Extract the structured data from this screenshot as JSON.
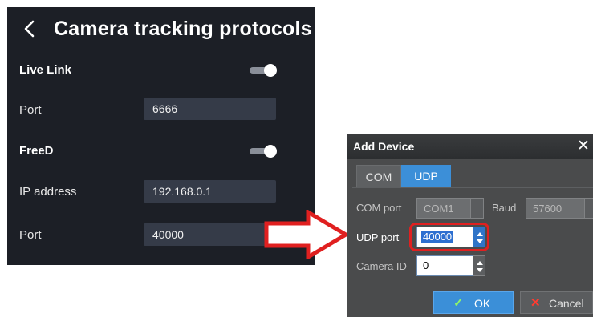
{
  "mobile": {
    "title": "Camera tracking protocols",
    "live_link": {
      "label": "Live Link",
      "enabled": true
    },
    "live_link_port": {
      "label": "Port",
      "value": "6666"
    },
    "freed": {
      "label": "FreeD",
      "enabled": true
    },
    "ip_address": {
      "label": "IP address",
      "value": "192.168.0.1"
    },
    "freed_port": {
      "label": "Port",
      "value": "40000"
    }
  },
  "dialog": {
    "title": "Add Device",
    "close_glyph": "✕",
    "tabs": [
      {
        "label": "COM",
        "active": false
      },
      {
        "label": "UDP",
        "active": true
      }
    ],
    "com_port": {
      "label": "COM port",
      "value": "COM1"
    },
    "baud": {
      "label": "Baud",
      "value": "57600"
    },
    "udp_port": {
      "label": "UDP port",
      "value": "40000"
    },
    "camera_id": {
      "label": "Camera ID",
      "value": "0"
    },
    "ok": {
      "label": "OK",
      "icon": "checkmark-icon",
      "glyph": "✓"
    },
    "cancel": {
      "label": "Cancel",
      "icon": "x-icon",
      "glyph": "✕"
    }
  },
  "colors": {
    "panel_bg": "#1c1f26",
    "field_bg": "#353b48",
    "accent_blue": "#3b8fd8",
    "highlight_red": "#e02020"
  }
}
